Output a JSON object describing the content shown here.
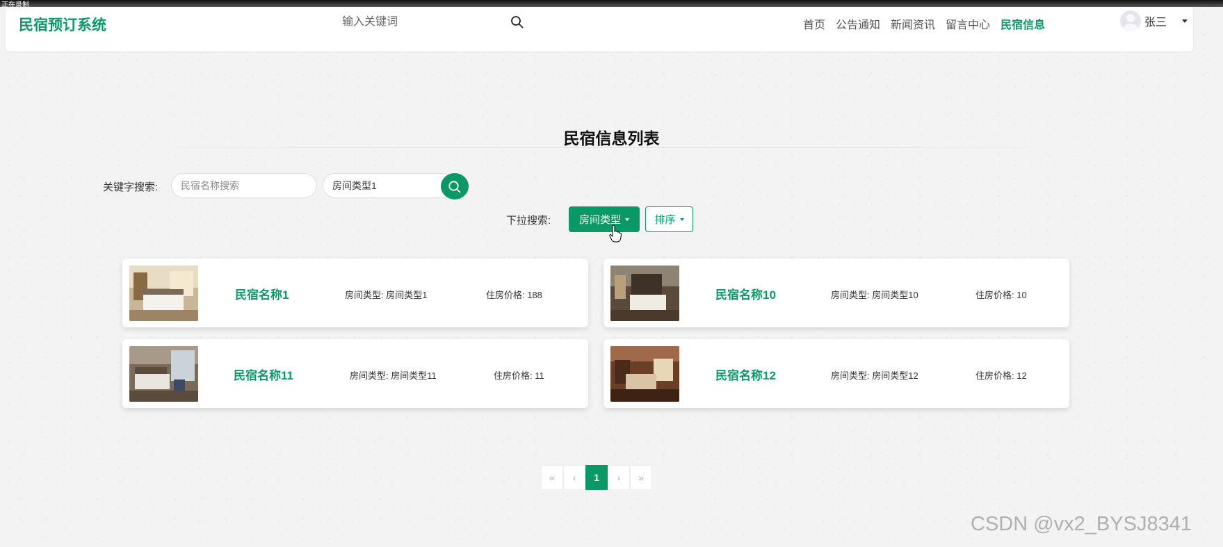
{
  "recording_label": "正在录制",
  "header": {
    "brand": "民宿预订系统",
    "search_placeholder": "输入关键词",
    "nav": [
      "首页",
      "公告通知",
      "新闻资讯",
      "留言中心",
      "民宿信息"
    ],
    "active_nav": "民宿信息",
    "username": "张三"
  },
  "main": {
    "title": "民宿信息列表",
    "keyword_label": "关键字搜索:",
    "name_placeholder": "民宿名称搜索",
    "roomtype_value": "房间类型1",
    "dropdown_label": "下拉搜索:",
    "roomtype_button": "房间类型",
    "sort_button": "排序"
  },
  "cards": [
    {
      "name": "民宿名称1",
      "room_type": "房间类型: 房间类型1",
      "price": "住房价格: 188"
    },
    {
      "name": "民宿名称10",
      "room_type": "房间类型: 房间类型10",
      "price": "住房价格: 10"
    },
    {
      "name": "民宿名称11",
      "room_type": "房间类型: 房间类型11",
      "price": "住房价格: 11"
    },
    {
      "name": "民宿名称12",
      "room_type": "房间类型: 房间类型12",
      "price": "住房价格: 12"
    }
  ],
  "pagination": {
    "first": "«",
    "prev": "‹",
    "current": "1",
    "next": "›",
    "last": "»"
  },
  "watermark": "CSDN @vx2_BYSJ8341",
  "colors": {
    "accent": "#0a9866",
    "background": "#f3f3f3"
  }
}
